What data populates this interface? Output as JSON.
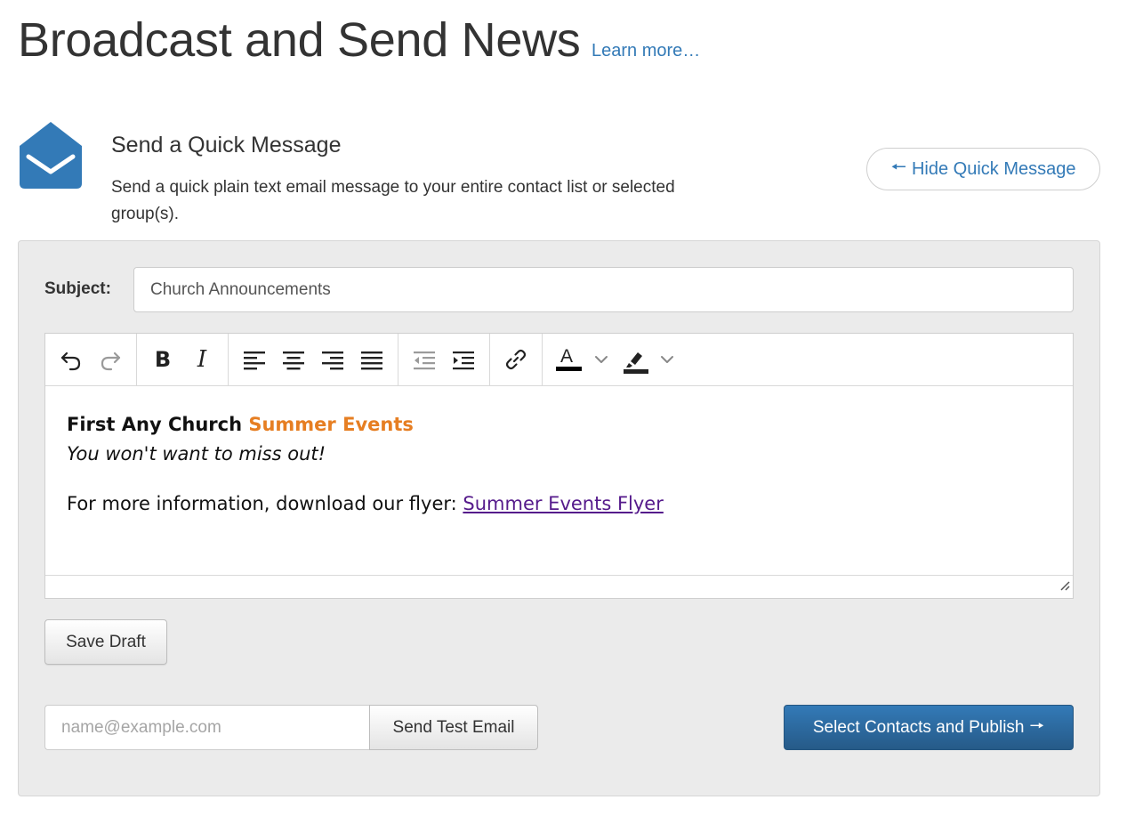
{
  "header": {
    "title": "Broadcast and Send News",
    "learn_more": "Learn more…"
  },
  "quick_message": {
    "heading": "Send a Quick Message",
    "description": "Send a quick plain text email message to your entire contact list or selected group(s).",
    "hide_button_label": "Hide Quick Message",
    "hide_button_arrow": "🠔",
    "icon": "envelope-open-icon"
  },
  "form": {
    "subject_label": "Subject:",
    "subject_value": "Church Announcements"
  },
  "editor": {
    "toolbar_icons": [
      "undo-icon",
      "redo-icon",
      "bold-icon",
      "italic-icon",
      "align-left-icon",
      "align-center-icon",
      "align-right-icon",
      "align-justify-icon",
      "outdent-icon",
      "indent-icon",
      "link-icon",
      "text-color-icon",
      "highlight-color-icon"
    ],
    "bold_label": "B",
    "italic_label": "I",
    "text_color_letter": "A",
    "content": {
      "line1_bold": "First Any Church ",
      "line1_orange": "Summer Events",
      "line2_italic": "You won't want to miss out!",
      "line3_text": "For more information, download our flyer: ",
      "line3_link": "Summer Events Flyer"
    }
  },
  "actions": {
    "save_draft": "Save Draft",
    "test_email_placeholder": "name@example.com",
    "send_test": "Send Test Email",
    "publish": "Select Contacts and Publish",
    "publish_arrow": "🠖"
  },
  "colors": {
    "brand_blue": "#337ab7",
    "orange_text": "#e67e22",
    "link_visited": "#551a8b",
    "panel_bg": "#ebebeb"
  }
}
